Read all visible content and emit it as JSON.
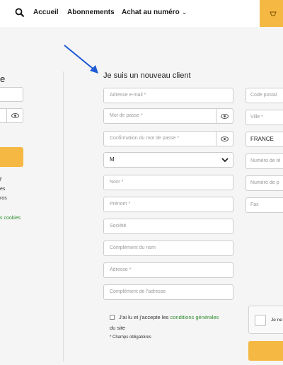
{
  "nav": {
    "links": [
      "Accueil",
      "Abonnements",
      "Achat au numéro"
    ],
    "achat_chevron": "⌄"
  },
  "left": {
    "title_fragment": "e",
    "lines": [
      "l'",
      "es",
      "ros"
    ],
    "cookies_fragment": "s cookies"
  },
  "register": {
    "title": "Je suis un nouveau client",
    "email_placeholder": "Adresse e-mail *",
    "password_placeholder": "Mot de passe *",
    "confirm_placeholder": "Confirmation du mot de passe *",
    "civility_value": "M",
    "lastname_placeholder": "Nom *",
    "firstname_placeholder": "Prénom *",
    "company_placeholder": "Société",
    "name_complement_placeholder": "Complément du nom",
    "address_placeholder": "Adresse *",
    "address_complement_placeholder": "Complément de l'adresse",
    "cgv_prefix": "J'ai lu et j'accepte les",
    "cgv_link": "conditions générales",
    "cgv_suffix": "du site",
    "required_note": "* Champs obligatoires"
  },
  "right": {
    "postal_placeholder": "Code postal",
    "city_placeholder": "Ville *",
    "country_value": "FRANCE",
    "phone_placeholder": "Numéro de té",
    "phone2_placeholder": "Numéro de p",
    "fax_placeholder": "Fax",
    "captcha_text": "Je ne"
  },
  "colors": {
    "accent": "#f5b843",
    "link_green": "#2e8b2e",
    "arrow_blue": "#1f5bd6",
    "band": "#f5f5f5"
  },
  "icons": [
    "search-icon",
    "cart-icon",
    "eye-icon",
    "chevron-down-icon",
    "annotation-arrow-icon"
  ]
}
